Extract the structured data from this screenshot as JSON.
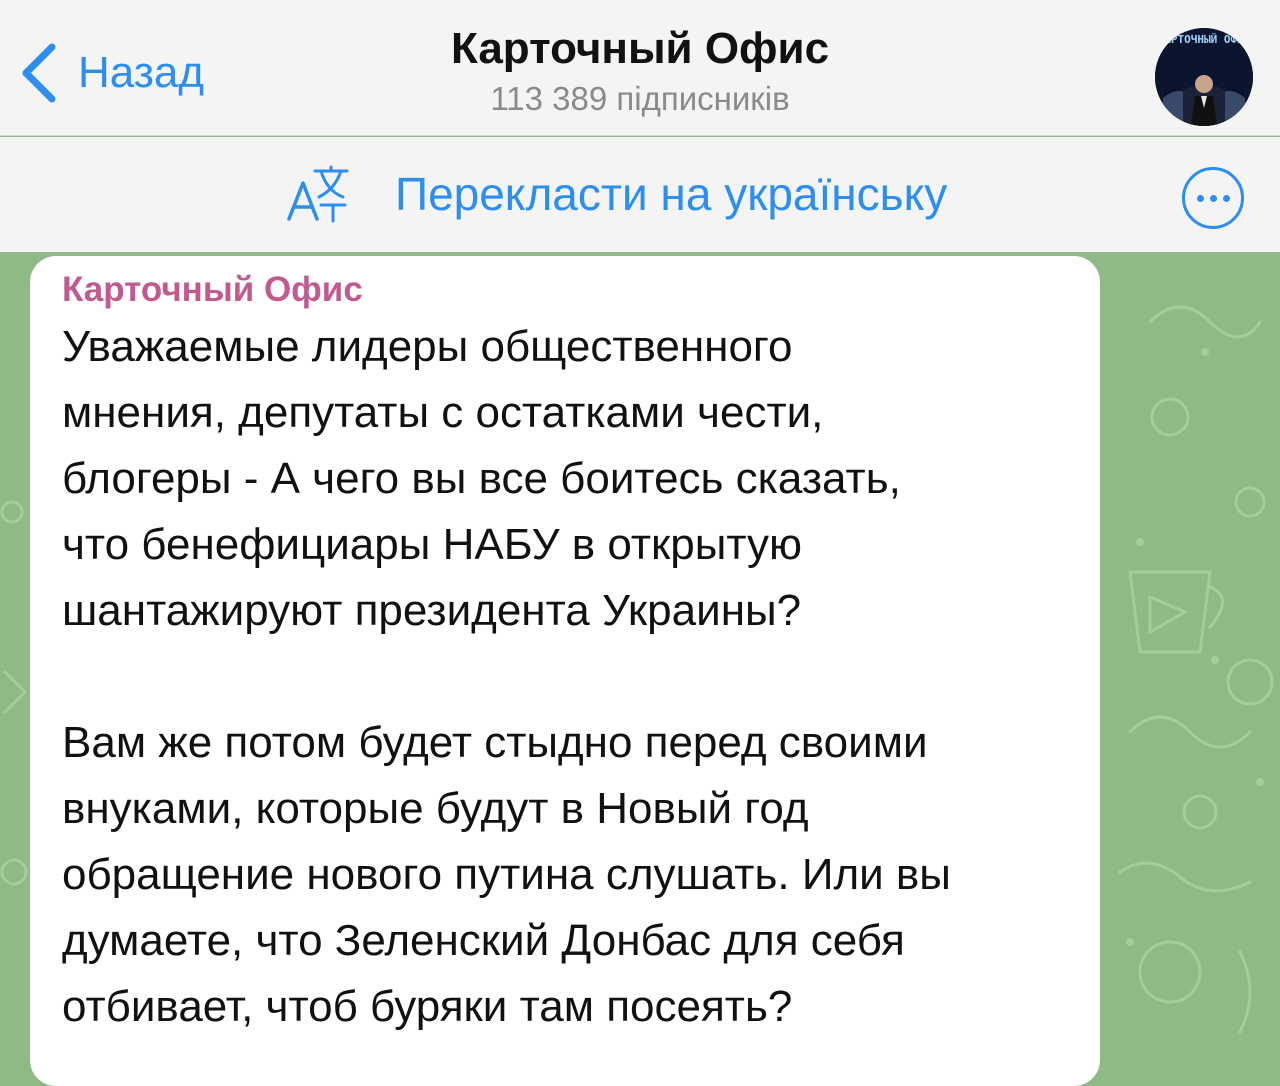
{
  "header": {
    "back_label": "Назад",
    "title": "Карточный Офис",
    "subtitle": "113 389 підписників",
    "avatar_text": "КАРТОЧНЫЙ ОФИС"
  },
  "translate_bar": {
    "label": "Перекласти на українську"
  },
  "message": {
    "sender": "Карточный Офис",
    "paragraph1": "Уважаемые лидеры общественного\nмнения, депутаты с остатками чести,\nблогеры - А чего вы все боитесь сказать,\nчто бенефициары НАБУ в открытую\nшантажируют президента Украины?",
    "paragraph2": "Вам же потом будет стыдно перед своими\nвнуками, которые будут в Новый год\nобращение нового путина слушать. Или вы\nдумаете, что Зеленский Донбас для себя\nотбивает, чтоб буряки там посеять?"
  },
  "colors": {
    "accent": "#2b8ef0",
    "sender": "#c25a8f",
    "chat_background": "#8fba85"
  }
}
